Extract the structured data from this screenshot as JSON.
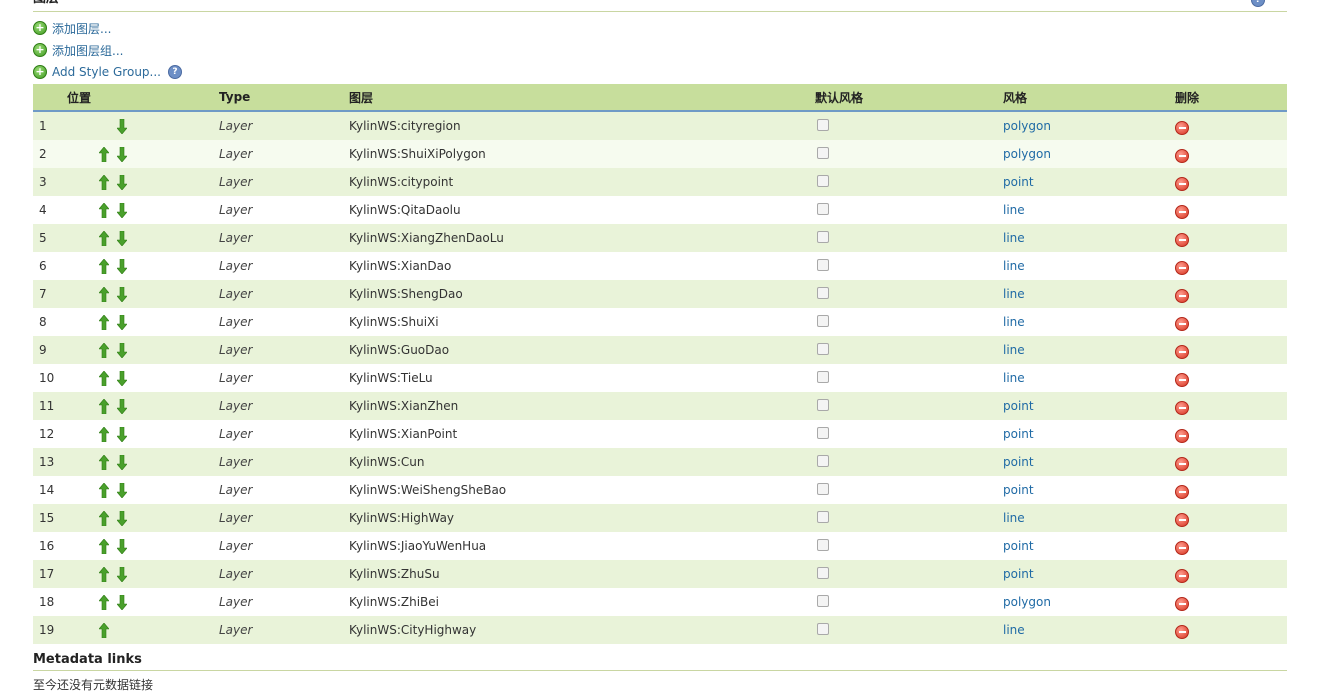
{
  "section": {
    "title": "图层"
  },
  "actions": {
    "add_layer": "添加图层...",
    "add_layer_group": "添加图层组...",
    "add_style_group": "Add Style Group..."
  },
  "table": {
    "headers": {
      "position": "位置",
      "type": "Type",
      "layer": "图层",
      "default_style": "默认风格",
      "style": "风格",
      "delete": "删除"
    },
    "rows": [
      {
        "index": "1",
        "type": "Layer",
        "layer": "KylinWS:cityregion",
        "style": "polygon",
        "up": false,
        "down": true
      },
      {
        "index": "2",
        "type": "Layer",
        "layer": "KylinWS:ShuiXiPolygon",
        "style": "polygon",
        "up": true,
        "down": true
      },
      {
        "index": "3",
        "type": "Layer",
        "layer": "KylinWS:citypoint",
        "style": "point",
        "up": true,
        "down": true
      },
      {
        "index": "4",
        "type": "Layer",
        "layer": "KylinWS:QitaDaolu",
        "style": "line",
        "up": true,
        "down": true
      },
      {
        "index": "5",
        "type": "Layer",
        "layer": "KylinWS:XiangZhenDaoLu",
        "style": "line",
        "up": true,
        "down": true
      },
      {
        "index": "6",
        "type": "Layer",
        "layer": "KylinWS:XianDao",
        "style": "line",
        "up": true,
        "down": true
      },
      {
        "index": "7",
        "type": "Layer",
        "layer": "KylinWS:ShengDao",
        "style": "line",
        "up": true,
        "down": true
      },
      {
        "index": "8",
        "type": "Layer",
        "layer": "KylinWS:ShuiXi",
        "style": "line",
        "up": true,
        "down": true
      },
      {
        "index": "9",
        "type": "Layer",
        "layer": "KylinWS:GuoDao",
        "style": "line",
        "up": true,
        "down": true
      },
      {
        "index": "10",
        "type": "Layer",
        "layer": "KylinWS:TieLu",
        "style": "line",
        "up": true,
        "down": true
      },
      {
        "index": "11",
        "type": "Layer",
        "layer": "KylinWS:XianZhen",
        "style": "point",
        "up": true,
        "down": true
      },
      {
        "index": "12",
        "type": "Layer",
        "layer": "KylinWS:XianPoint",
        "style": "point",
        "up": true,
        "down": true
      },
      {
        "index": "13",
        "type": "Layer",
        "layer": "KylinWS:Cun",
        "style": "point",
        "up": true,
        "down": true
      },
      {
        "index": "14",
        "type": "Layer",
        "layer": "KylinWS:WeiShengSheBao",
        "style": "point",
        "up": true,
        "down": true
      },
      {
        "index": "15",
        "type": "Layer",
        "layer": "KylinWS:HighWay",
        "style": "line",
        "up": true,
        "down": true
      },
      {
        "index": "16",
        "type": "Layer",
        "layer": "KylinWS:JiaoYuWenHua",
        "style": "point",
        "up": true,
        "down": true
      },
      {
        "index": "17",
        "type": "Layer",
        "layer": "KylinWS:ZhuSu",
        "style": "point",
        "up": true,
        "down": true
      },
      {
        "index": "18",
        "type": "Layer",
        "layer": "KylinWS:ZhiBei",
        "style": "polygon",
        "up": true,
        "down": true
      },
      {
        "index": "19",
        "type": "Layer",
        "layer": "KylinWS:CityHighway",
        "style": "line",
        "up": true,
        "down": false
      }
    ]
  },
  "metadata": {
    "title": "Metadata links",
    "empty_text": "至今还没有元数据链接"
  },
  "icons": {
    "add": "add-icon",
    "help": "help-icon",
    "up": "arrow-up-icon",
    "down": "arrow-down-icon",
    "delete": "delete-icon"
  },
  "colors": {
    "header_bg": "#c7de9c",
    "row_alt": "#e9f3d9",
    "link": "#1f6aa5",
    "arrow": "#4aa02c",
    "delete": "#d6321e"
  }
}
